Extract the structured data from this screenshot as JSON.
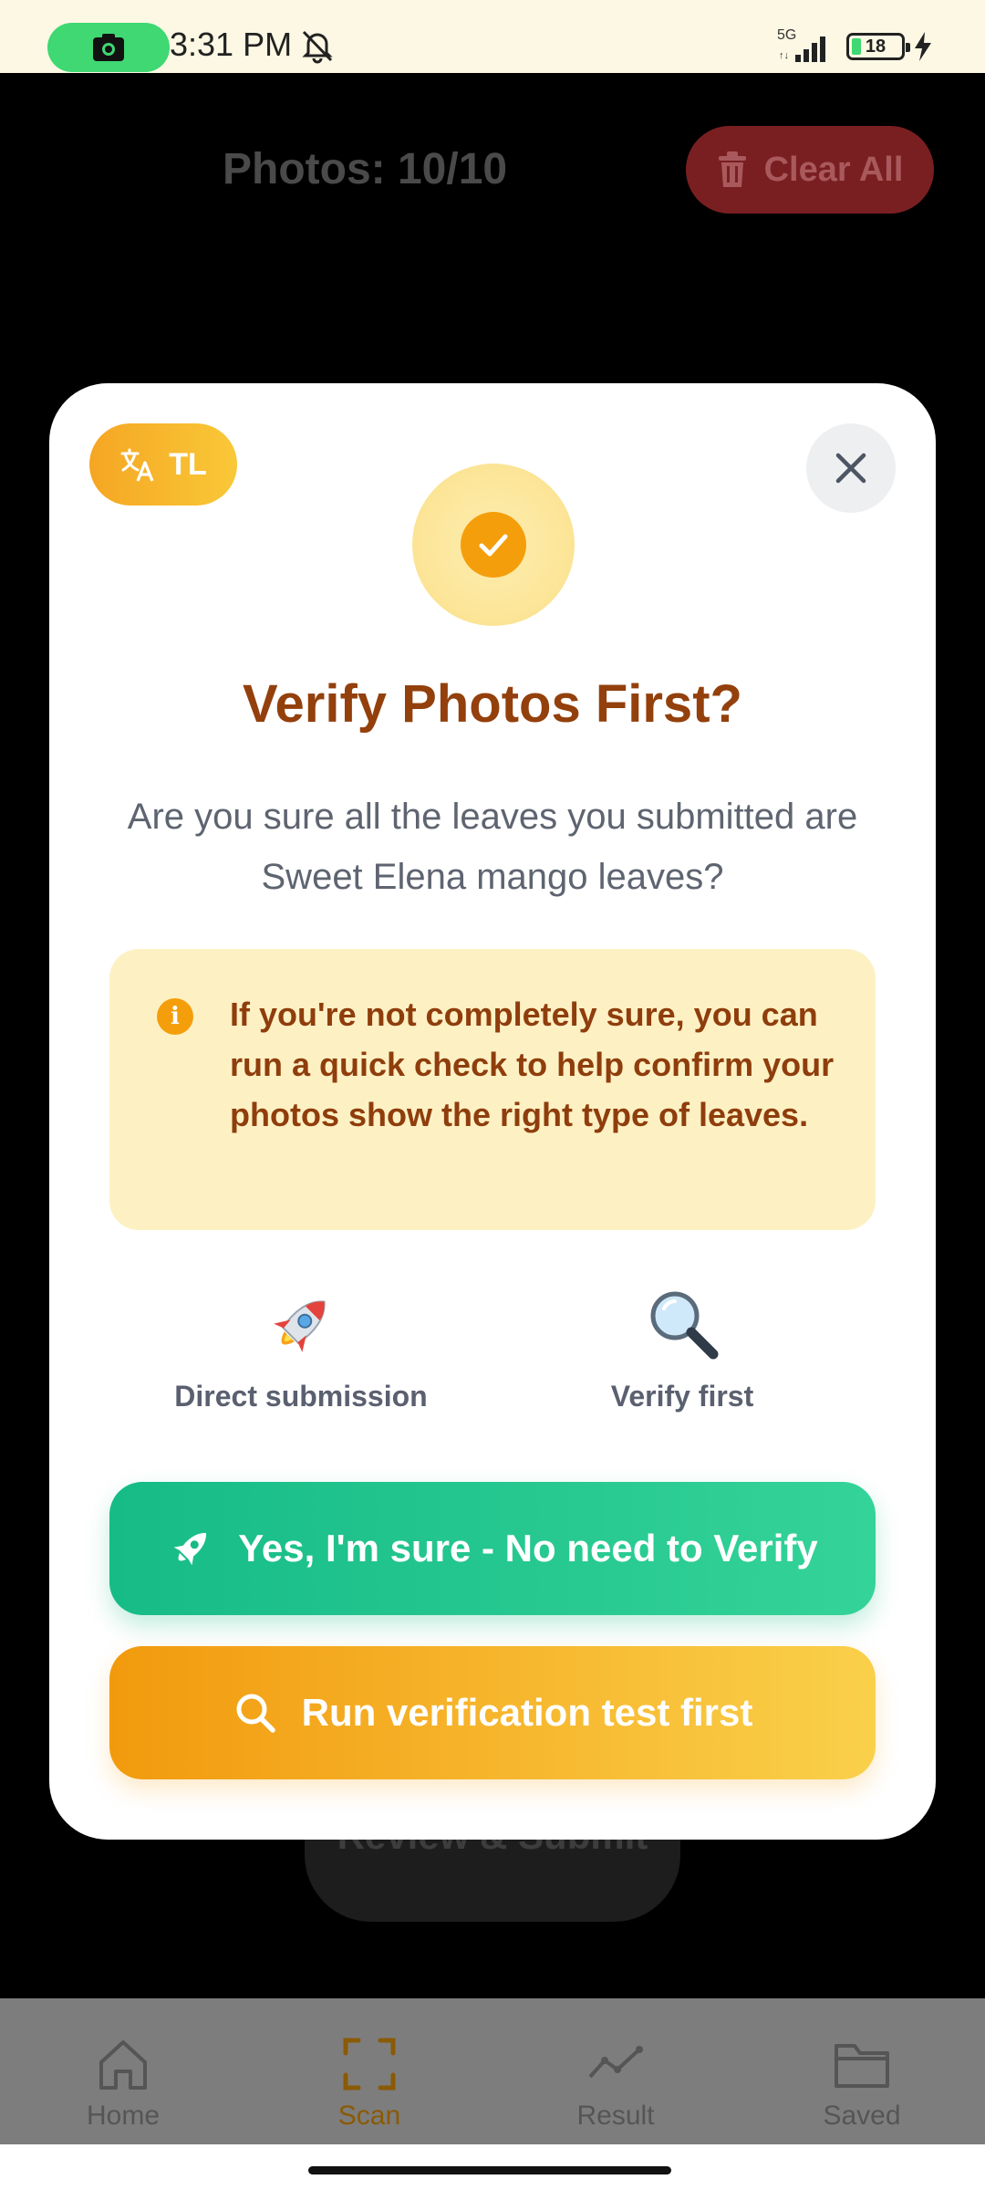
{
  "status_bar": {
    "time": "3:31 PM",
    "network": "5G",
    "battery_level": "18",
    "recording_indicator": "camera-icon"
  },
  "screen": {
    "photos_count": "Photos: 10/10",
    "clear_all_label": "Clear All",
    "review_submit_label": "Review & Submit"
  },
  "modal": {
    "language_button": "TL",
    "title": "Verify Photos First?",
    "question": "Are you sure all the leaves you submitted are Sweet Elena mango leaves?",
    "info_icon": "i",
    "info_text": "If you're not completely sure, you can run a quick check to help confirm your photos show the right type of leaves.",
    "options": [
      {
        "icon": "rocket-icon",
        "label": "Direct submission"
      },
      {
        "icon": "magnifier-icon",
        "label": "Verify first"
      }
    ],
    "confirm_button": "Yes, I'm sure - No need to Verify",
    "verify_button": "Run verification test first"
  },
  "bottom_nav": {
    "items": [
      {
        "label": "Home",
        "icon": "home-icon",
        "active": false
      },
      {
        "label": "Scan",
        "icon": "scan-icon",
        "active": true
      },
      {
        "label": "Result",
        "icon": "trend-icon",
        "active": false
      },
      {
        "label": "Saved",
        "icon": "folder-icon",
        "active": false
      }
    ]
  },
  "colors": {
    "title": "#93400c",
    "accent_orange": "#f59e0b",
    "accent_green": "#10b981",
    "danger": "#7a1f21"
  }
}
